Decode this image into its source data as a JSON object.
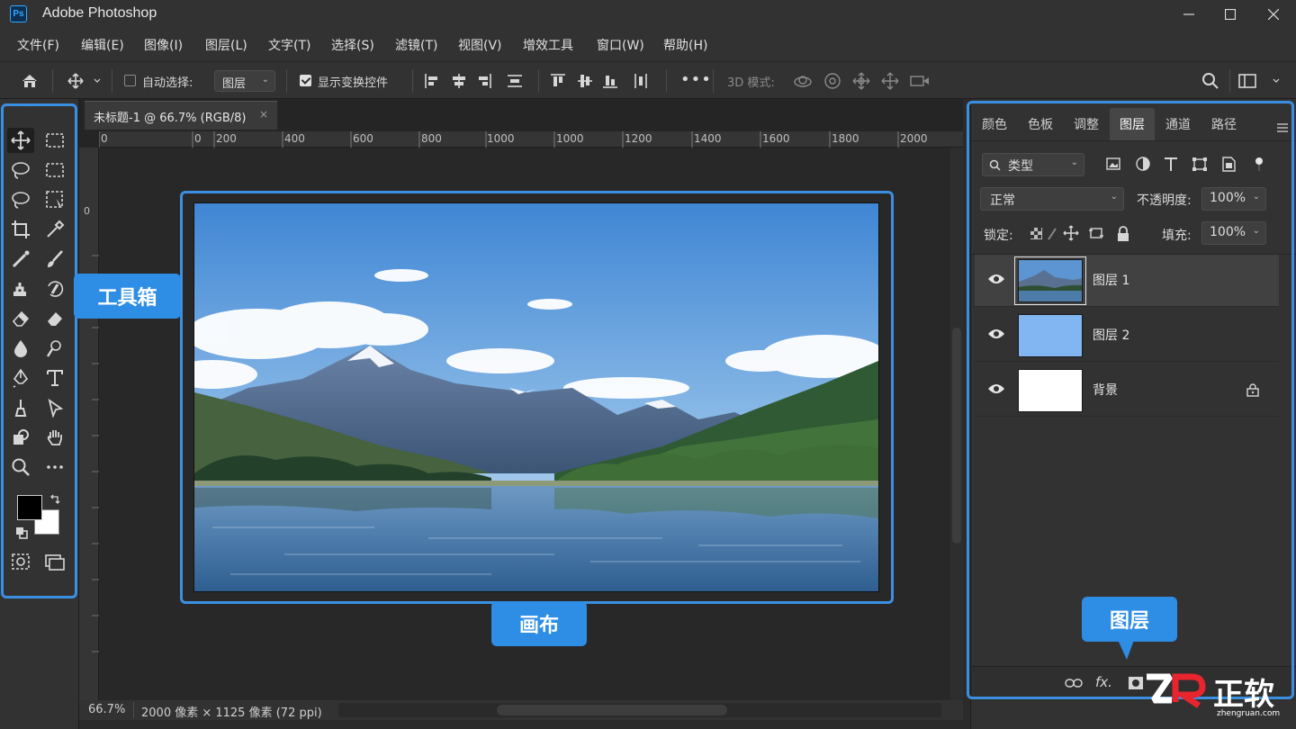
{
  "window": {
    "title": "Adobe Photoshop",
    "logo": "Ps"
  },
  "menu": [
    "文件(F)",
    "编辑(E)",
    "图像(I)",
    "图层(L)",
    "文字(T)",
    "选择(S)",
    "滤镜(T)",
    "视图(V)",
    "增效工具",
    "窗口(W)",
    "帮助(H)"
  ],
  "options": {
    "auto_select_label": "自动选择:",
    "auto_select_checked": false,
    "auto_select_value": "图层",
    "show_transform_label": "显示变换控件",
    "show_transform_checked": true,
    "mode_3d_label": "3D 模式:",
    "more": "•••"
  },
  "document": {
    "tab_title": "未标题-1 @ 66.7% (RGB/8)",
    "tab_close": "×",
    "ruler_top": [
      "0",
      "0",
      "200",
      "400",
      "600",
      "800",
      "1000",
      "1000",
      "1200",
      "1400",
      "1600",
      "1800",
      "2000"
    ],
    "ruler_left": [
      "0"
    ]
  },
  "status": {
    "zoom": "66.7%",
    "info": "2000 像素 × 1125 像素 (72 ppi)"
  },
  "panel": {
    "tabs": [
      "颜色",
      "色板",
      "调整",
      "图层",
      "通道",
      "路径"
    ],
    "active_tab": "图层",
    "filter_label": "类型",
    "blend_mode": "正常",
    "opacity_label": "不透明度:",
    "opacity_value": "100%",
    "lock_label": "锁定:",
    "fill_label": "填充:",
    "fill_value": "100%",
    "layers": [
      {
        "name": "图层 1",
        "selected": true,
        "locked": false
      },
      {
        "name": "图层 2",
        "selected": false,
        "locked": false
      },
      {
        "name": "背景",
        "selected": false,
        "locked": true
      }
    ],
    "bottom_fx": "fx."
  },
  "annotations": {
    "toolbox": "工具箱",
    "canvas": "画布",
    "layers": "图层"
  },
  "watermark": {
    "brand": "正软",
    "url": "zhengruan.com"
  },
  "colors": {
    "accent": "#2e8de5",
    "bg": "#323232",
    "canvas_bg": "#282828"
  }
}
